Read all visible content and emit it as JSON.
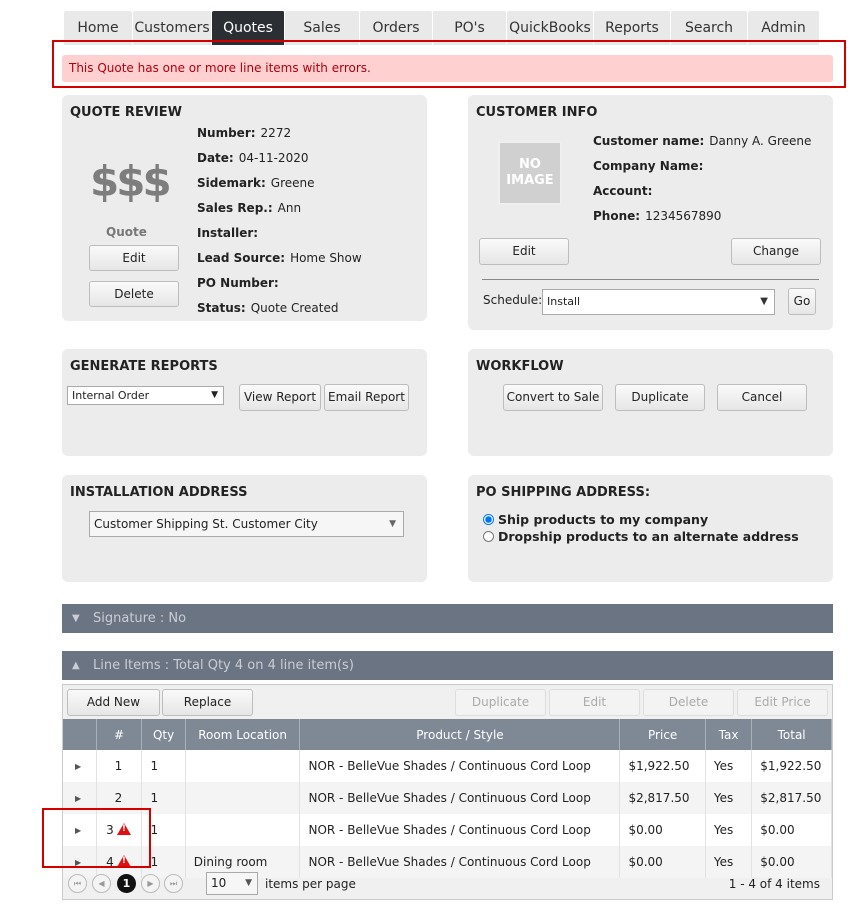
{
  "nav": {
    "tabs": [
      "Home",
      "Customers",
      "Quotes",
      "Sales",
      "Orders",
      "PO's",
      "QuickBooks",
      "Reports",
      "Search",
      "Admin"
    ],
    "active": "Quotes"
  },
  "error": {
    "message": "This Quote has one or more line items with errors."
  },
  "quote_review": {
    "title": "QUOTE REVIEW",
    "icon_text": "$$$",
    "icon_caption": "Quote",
    "edit_label": "Edit",
    "delete_label": "Delete",
    "fields": [
      {
        "label": "Number:",
        "value": "2272"
      },
      {
        "label": "Date:",
        "value": "04-11-2020"
      },
      {
        "label": "Sidemark:",
        "value": "Greene"
      },
      {
        "label": "Sales Rep.:",
        "value": "Ann"
      },
      {
        "label": "Installer:",
        "value": ""
      },
      {
        "label": "Lead Source:",
        "value": "Home Show"
      },
      {
        "label": "PO Number:",
        "value": ""
      },
      {
        "label": "Status:",
        "value": "Quote Created"
      }
    ]
  },
  "customer_info": {
    "title": "CUSTOMER INFO",
    "no_image_line1": "NO",
    "no_image_line2": "IMAGE",
    "fields": [
      {
        "label": "Customer name:",
        "value": "Danny A. Greene"
      },
      {
        "label": "Company Name:",
        "value": ""
      },
      {
        "label": "Account:",
        "value": ""
      },
      {
        "label": "Phone:",
        "value": "1234567890"
      }
    ],
    "edit_label": "Edit",
    "change_label": "Change",
    "schedule_label": "Schedule:",
    "schedule_value": "Install",
    "go_label": "Go"
  },
  "generate_reports": {
    "title": "GENERATE REPORTS",
    "report_value": "Internal Order",
    "view_label": "View Report",
    "email_label": "Email Report"
  },
  "workflow": {
    "title": "WORKFLOW",
    "convert_label": "Convert to Sale",
    "duplicate_label": "Duplicate",
    "cancel_label": "Cancel"
  },
  "installation": {
    "title": "INSTALLATION ADDRESS",
    "address": "Customer Shipping St. Customer City"
  },
  "po_shipping": {
    "title": "PO SHIPPING ADDRESS:",
    "options": [
      "Ship products to my company",
      "Dropship products to an alternate address"
    ],
    "selected": 0
  },
  "signature": {
    "label": "Signature : No"
  },
  "line_items": {
    "header": "Line Items : Total Qty 4 on 4 line item(s)",
    "toolbar": {
      "add_new": "Add New",
      "replace": "Replace",
      "duplicate": "Duplicate",
      "edit": "Edit",
      "delete": "Delete",
      "edit_price": "Edit Price"
    },
    "columns": [
      "#",
      "Qty",
      "Room Location",
      "Product / Style",
      "Price",
      "Tax",
      "Total"
    ],
    "rows": [
      {
        "num": "1",
        "qty": "1",
        "room": "",
        "product": "NOR - BelleVue Shades / Continuous Cord Loop",
        "price": "$1,922.50",
        "tax": "Yes",
        "total": "$1,922.50",
        "error": false
      },
      {
        "num": "2",
        "qty": "1",
        "room": "",
        "product": "NOR - BelleVue Shades / Continuous Cord Loop",
        "price": "$2,817.50",
        "tax": "Yes",
        "total": "$2,817.50",
        "error": false
      },
      {
        "num": "3",
        "qty": "1",
        "room": "",
        "product": "NOR - BelleVue Shades / Continuous Cord Loop",
        "price": "$0.00",
        "tax": "Yes",
        "total": "$0.00",
        "error": true
      },
      {
        "num": "4",
        "qty": "1",
        "room": "Dining room",
        "product": "NOR - BelleVue Shades / Continuous Cord Loop",
        "price": "$0.00",
        "tax": "Yes",
        "total": "$0.00",
        "error": true
      }
    ],
    "pager": {
      "current_page": "1",
      "page_size": "10",
      "per_page_label": "items per page",
      "summary": "1 - 4 of 4 items"
    }
  },
  "colors": {
    "accent_dark": "#2b2f33",
    "error_bg": "#ffd0d0",
    "error_text": "#b3000d",
    "highlight_red": "#d40000",
    "grid_header": "#7f8996"
  }
}
